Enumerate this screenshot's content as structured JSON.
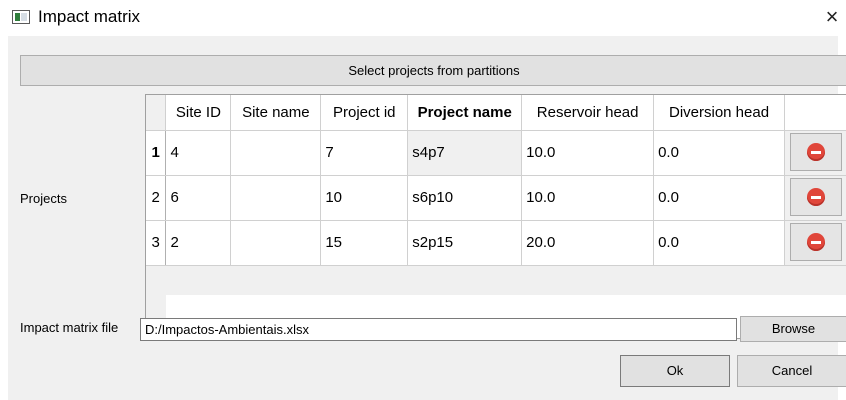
{
  "window": {
    "title": "Impact matrix",
    "close_glyph": "×"
  },
  "select_button": {
    "label": "Select projects from partitions"
  },
  "projects_label": "Projects",
  "table": {
    "columns": [
      "Site ID",
      "Site name",
      "Project id",
      "Project name",
      "Reservoir head",
      "Diversion head"
    ],
    "rows": [
      {
        "num": "1",
        "cells": [
          "4",
          "",
          "7",
          "s4p7",
          "10.0",
          "0.0"
        ]
      },
      {
        "num": "2",
        "cells": [
          "6",
          "",
          "10",
          "s6p10",
          "10.0",
          "0.0"
        ]
      },
      {
        "num": "3",
        "cells": [
          "2",
          "",
          "15",
          "s2p15",
          "20.0",
          "0.0"
        ]
      }
    ],
    "delete_icon": "remove-circle-icon",
    "delete_icon_color": "#e0463a"
  },
  "impact_file": {
    "label": "Impact matrix file",
    "value": "D:/Impactos-Ambientais.xlsx"
  },
  "buttons": {
    "browse": "Browse",
    "ok": "Ok",
    "cancel": "Cancel"
  }
}
